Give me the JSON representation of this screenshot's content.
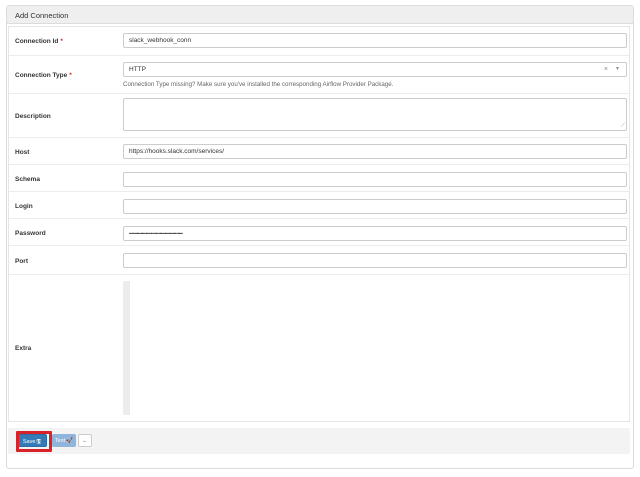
{
  "page": {
    "heading": "Add Connection"
  },
  "form": {
    "connection_id": {
      "label": "Connection Id",
      "required_mark": "*",
      "value": "slack_webhook_conn"
    },
    "connection_type": {
      "label": "Connection Type",
      "required_mark": "*",
      "value": "HTTP",
      "clear_glyph": "×",
      "caret_glyph": "▼",
      "help": "Connection Type missing? Make sure you've installed the corresponding Airflow Provider Package."
    },
    "description": {
      "label": "Description",
      "value": "",
      "resize_glyph": "⟋"
    },
    "host": {
      "label": "Host",
      "value": "https://hooks.slack.com/services/"
    },
    "schema": {
      "label": "Schema",
      "value": ""
    },
    "login": {
      "label": "Login",
      "value": ""
    },
    "password": {
      "label": "Password",
      "value": "••••••••••••••••••••••••••••••••••••••••••"
    },
    "port": {
      "label": "Port",
      "value": ""
    },
    "extra": {
      "label": "Extra",
      "value": ""
    }
  },
  "footer": {
    "save_label": "Save",
    "save_icon": "🖫",
    "test_label": "Test",
    "test_icon": "🚀",
    "back_icon": "←"
  },
  "colors": {
    "primary": "#337ab7",
    "highlight": "#d7222a",
    "required": "#c9302c"
  }
}
